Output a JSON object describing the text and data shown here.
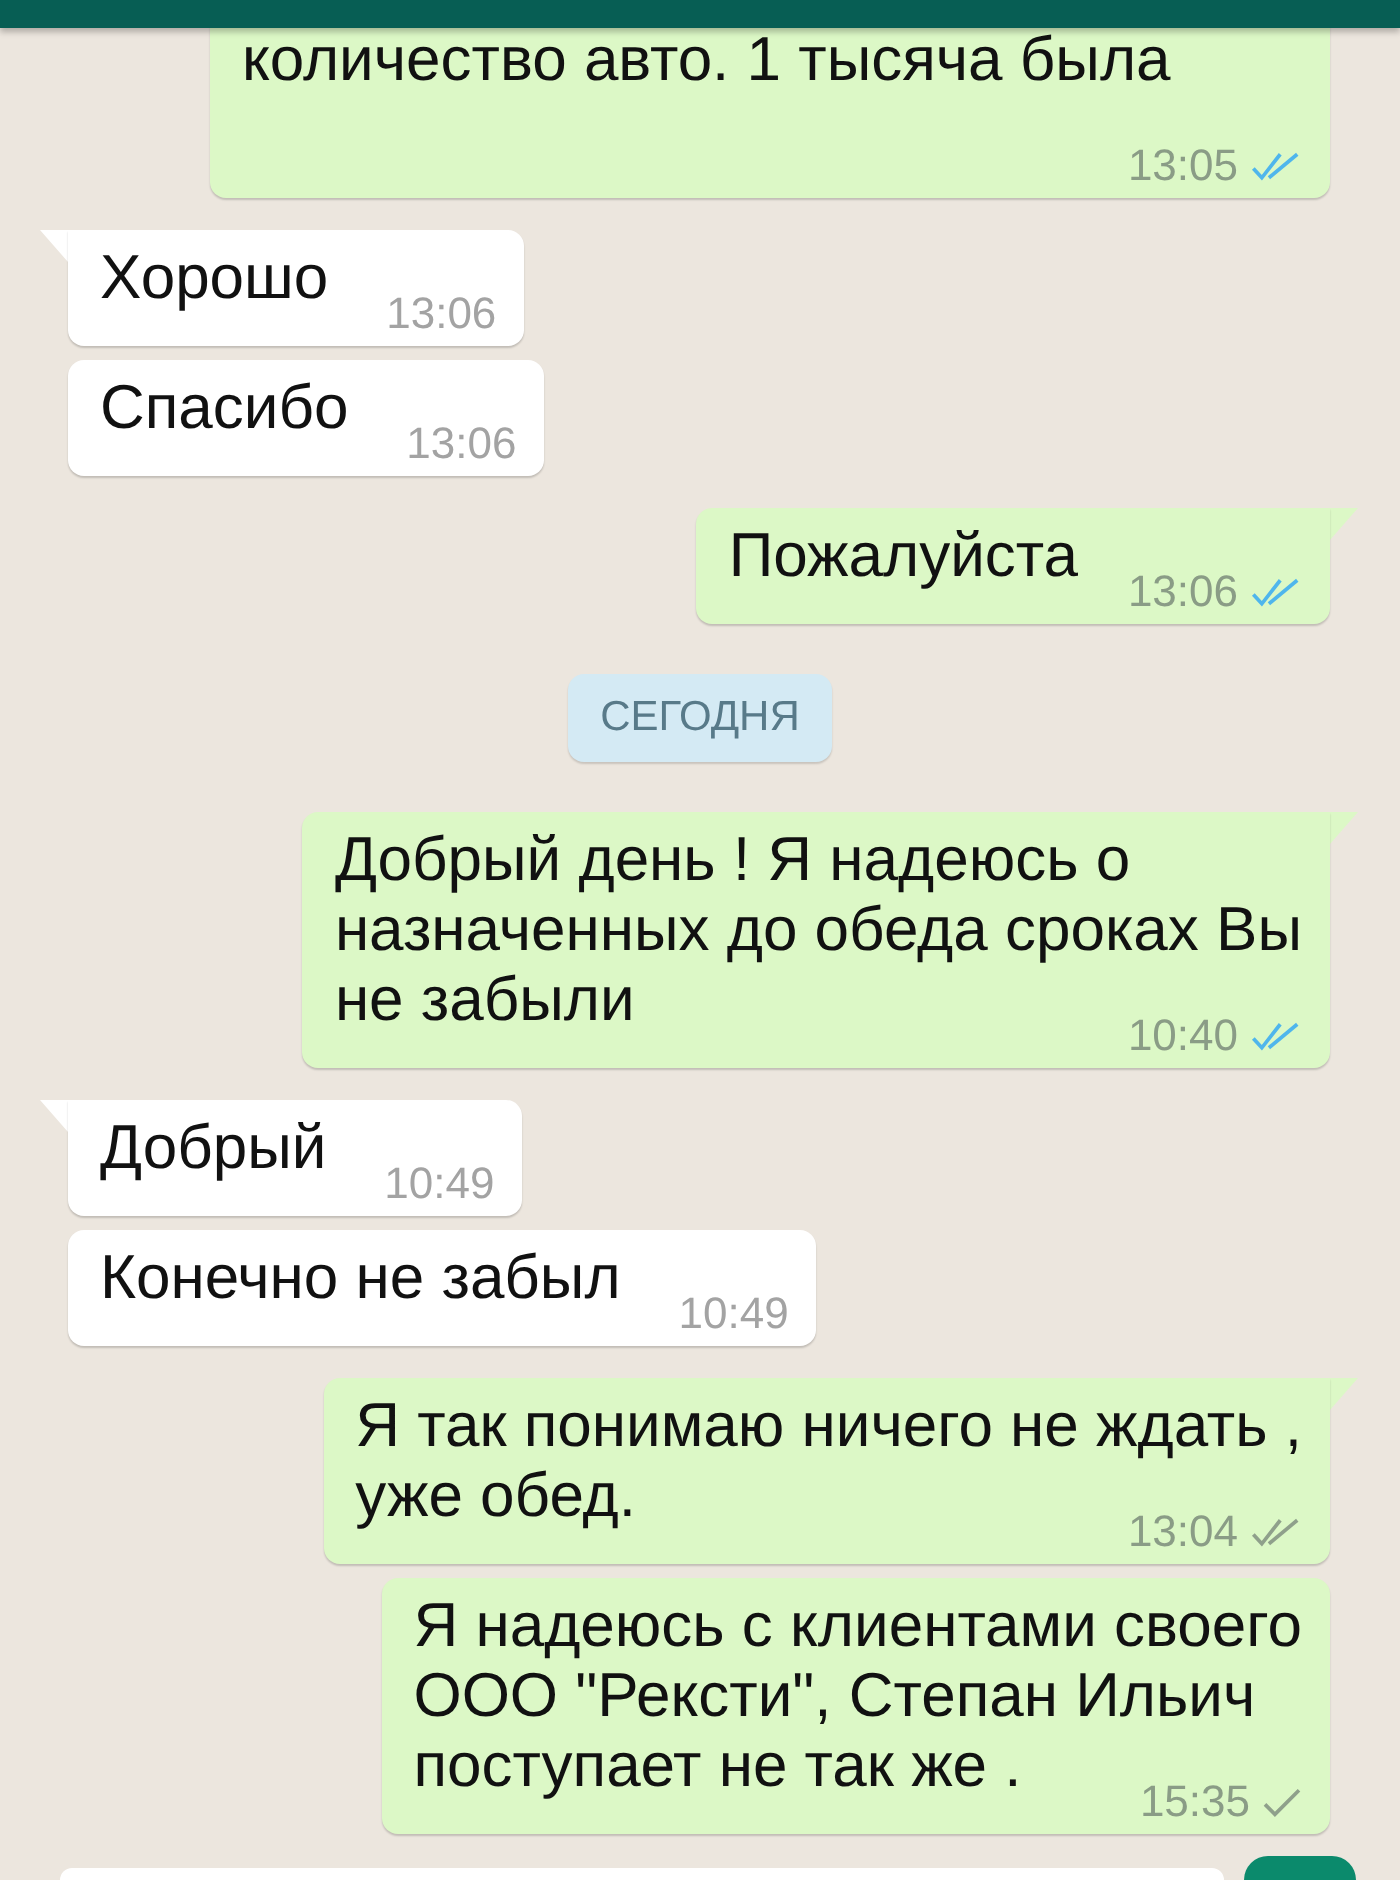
{
  "messages": [
    {
      "kind": "message",
      "outgoing": true,
      "tail": false,
      "lines": [
        "количество авто. 1 тысяча была"
      ],
      "time": "13:05",
      "delivered": true,
      "read": true
    },
    {
      "kind": "message",
      "outgoing": false,
      "tail": true,
      "lines": [
        "Хорошо"
      ],
      "time": "13:06"
    },
    {
      "kind": "message",
      "outgoing": false,
      "tail": false,
      "lines": [
        "Спасибо"
      ],
      "time": "13:06"
    },
    {
      "kind": "message",
      "outgoing": true,
      "tail": true,
      "lines": [
        "Пожалуйста"
      ],
      "time": "13:06",
      "delivered": true,
      "read": true
    },
    {
      "kind": "date",
      "label": "СЕГОДНЯ"
    },
    {
      "kind": "message",
      "outgoing": true,
      "tail": true,
      "lines": [
        "Добрый день ! Я надеюсь о",
        "назначенных до обеда сроках Вы",
        "не забыли"
      ],
      "time": "10:40",
      "delivered": true,
      "read": true
    },
    {
      "kind": "message",
      "outgoing": false,
      "tail": true,
      "lines": [
        "Добрый"
      ],
      "time": "10:49"
    },
    {
      "kind": "message",
      "outgoing": false,
      "tail": false,
      "lines": [
        "Конечно не забыл"
      ],
      "time": "10:49"
    },
    {
      "kind": "message",
      "outgoing": true,
      "tail": true,
      "lines": [
        "Я так понимаю ничего не ждать ,",
        "уже обед."
      ],
      "time": "13:04",
      "delivered": true,
      "read": false
    },
    {
      "kind": "message",
      "outgoing": true,
      "tail": false,
      "lines": [
        "Я надеюсь с клиентами своего",
        "ООО \"Рексти\", Степан Ильич",
        "поступает не так же ."
      ],
      "time": "15:35",
      "delivered": false,
      "read": false
    }
  ]
}
